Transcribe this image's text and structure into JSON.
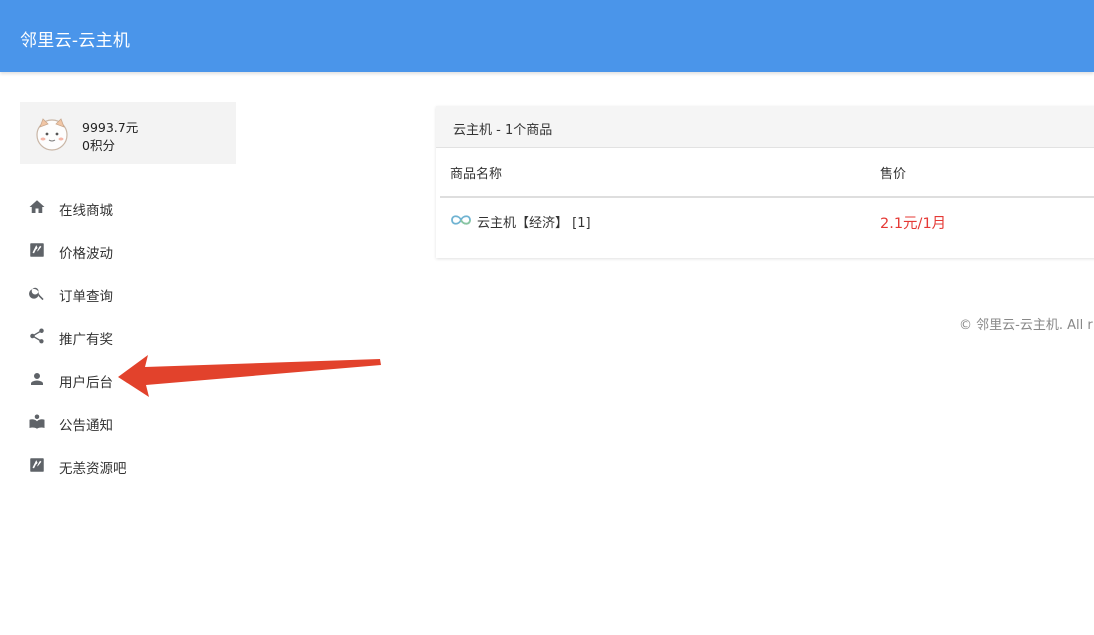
{
  "header": {
    "title": "邻里云-云主机"
  },
  "user": {
    "balance": "9993.7元",
    "points": "0积分"
  },
  "nav": {
    "items": [
      {
        "label": "在线商城",
        "icon": "home-icon"
      },
      {
        "label": "价格波动",
        "icon": "swap-icon"
      },
      {
        "label": "订单查询",
        "icon": "search-icon"
      },
      {
        "label": "推广有奖",
        "icon": "share-icon"
      },
      {
        "label": "用户后台",
        "icon": "person-icon"
      },
      {
        "label": "公告通知",
        "icon": "book-icon"
      },
      {
        "label": "无恙资源吧",
        "icon": "swap-icon"
      }
    ]
  },
  "panel": {
    "title": "云主机 - 1个商品",
    "columns": [
      "商品名称",
      "售价"
    ],
    "rows": [
      {
        "name": "云主机【经济】 [1]",
        "price": "2.1元/1月"
      }
    ]
  },
  "footer": {
    "text": "© 邻里云-云主机. All r"
  },
  "colors": {
    "header_bg": "#4a95ea",
    "price": "#e53935",
    "annotation_arrow": "#e2422c"
  }
}
